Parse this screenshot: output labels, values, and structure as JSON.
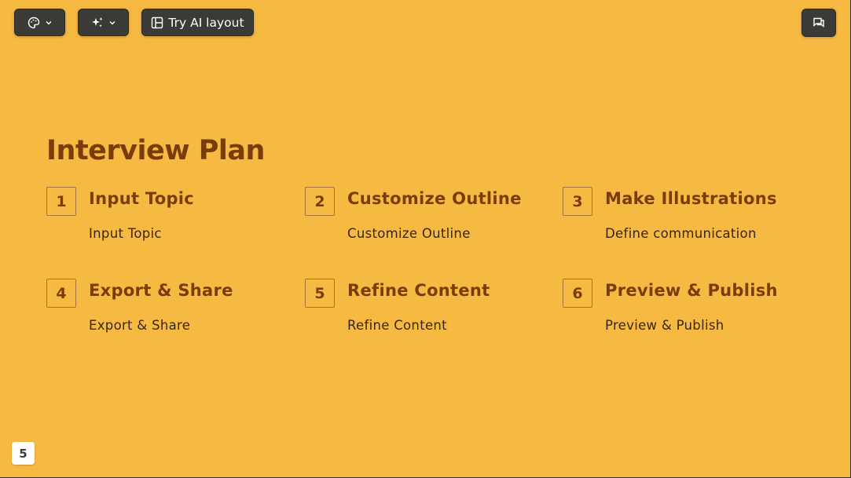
{
  "toolbar": {
    "theme_icon": "palette-icon",
    "ai_icon": "sparkles-icon",
    "layout_icon": "layout-icon",
    "layout_label": "Try AI layout",
    "comment_icon": "comment-icon",
    "chevron_icon": "chevron-down-icon"
  },
  "slide": {
    "title": "Interview Plan",
    "steps": [
      {
        "number": "1",
        "title": "Input Topic",
        "description": "Input Topic"
      },
      {
        "number": "2",
        "title": "Customize Outline",
        "description": "Customize Outline"
      },
      {
        "number": "3",
        "title": "Make Illustrations",
        "description": "Define communication"
      },
      {
        "number": "4",
        "title": "Export & Share",
        "description": "Export & Share"
      },
      {
        "number": "5",
        "title": "Refine Content",
        "description": "Refine Content"
      },
      {
        "number": "6",
        "title": "Preview & Publish",
        "description": "Preview & Publish"
      }
    ],
    "page_number": "5"
  },
  "colors": {
    "background": "#f6b942",
    "title": "#7a3d0a",
    "body_text": "#3b260e",
    "toolbar_button": "#3c3a36"
  }
}
